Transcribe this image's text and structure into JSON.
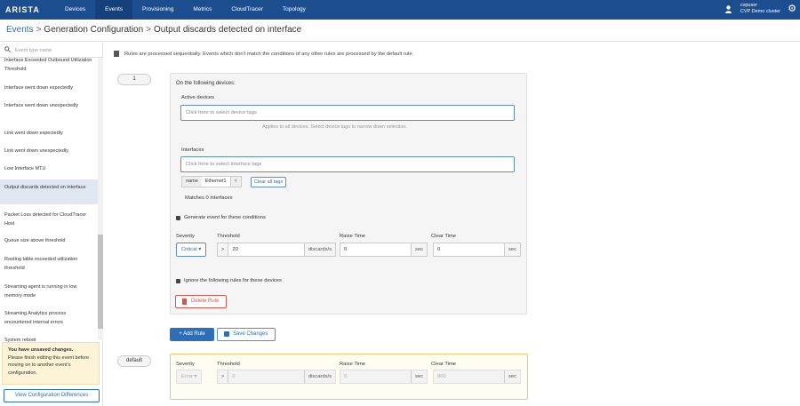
{
  "nav": {
    "logo": "ARISTA",
    "tabs": [
      "Devices",
      "Events",
      "Provisioning",
      "Metrics",
      "CloudTracer",
      "Topology"
    ],
    "active_tab": "Events",
    "user_name": "cvpuser",
    "cluster": "CVP Demo cluster"
  },
  "breadcrumb": {
    "home": "Events",
    "level2": "Generation Configuration",
    "level3": "Output discards detected on interface",
    "sep": ">"
  },
  "sidebar": {
    "search_placeholder": "Event type name",
    "items": [
      "Interface Exceeded Outbound Utilization Threshold",
      "Interface went down expectedly",
      "Interface went down unexpectedly",
      "Link went down expectedly",
      "Link went down unexpectedly",
      "Low Interface MTU",
      "Output discards detected on interface",
      "Packet Loss detected for CloudTracer Host",
      "Queue size above threshold",
      "Routing table exceeded utilization threshold",
      "Streaming agent is running in low memory mode",
      "Streaming Analytics process encountered internal errors",
      "System reboot"
    ],
    "warning_title": "You have unsaved changes.",
    "warning_text": "Please finish editing this event before moving on to another event's configuration.",
    "diff_button": "View Configuration Differences"
  },
  "main": {
    "info": "Rules are processed sequentially. Events which don't match the conditions of any other rules are processed by the default rule.",
    "rule_number": "1",
    "on_devices": "On the following devices:",
    "active_devices_label": "Active devices",
    "devices_placeholder": "Click here to select device tags",
    "devices_hint": "Applies to all devices. Select device tags to narrow down selection.",
    "interfaces_label": "Interfaces",
    "interfaces_placeholder": "Click here to select interface tags",
    "tag_key": "name",
    "tag_value": "Ethernet1",
    "tag_remove": "×",
    "clear_tags": "Clear all tags",
    "matches": "Matches 0 interfaces",
    "generate_label": "Generate event for these conditions",
    "severity_label": "Severity",
    "threshold_label": "Threshold",
    "raise_label": "Raise Time",
    "clear_label": "Clear Time",
    "severity_value": "Critical",
    "gt": ">",
    "threshold_value": "20",
    "threshold_unit": "discards/s",
    "raise_value": "0",
    "clear_value": "0",
    "sec": "sec",
    "ignore_label": "Ignore the following rules for these devices",
    "delete_rule": "Delete Rule",
    "add_rule": "+ Add Rule",
    "save_changes": "Save Changes",
    "default_label": "default",
    "default_severity": "Error",
    "default_threshold": "0",
    "default_raise": "0",
    "default_clear": "900"
  }
}
